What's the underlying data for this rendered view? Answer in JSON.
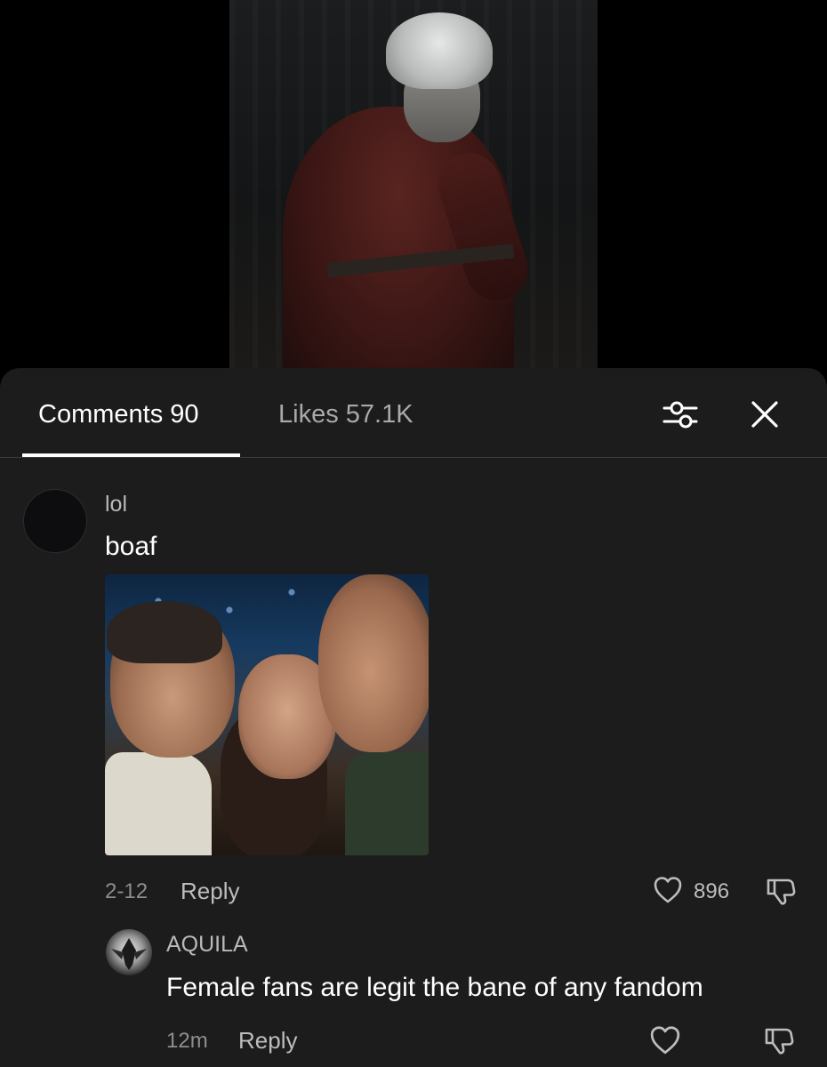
{
  "header": {
    "tabs": [
      {
        "label": "Comments 90",
        "active": true
      },
      {
        "label": "Likes 57.1K",
        "active": false
      }
    ],
    "icons": {
      "filter": "sliders-icon",
      "close": "close-icon"
    }
  },
  "comments": [
    {
      "username": "lol",
      "text": "boaf",
      "has_image": true,
      "date": "2-12",
      "reply_label": "Reply",
      "like_count": "896"
    },
    {
      "username": "AQUILA",
      "text": "Female fans are legit the bane of any fandom",
      "date": "12m",
      "reply_label": "Reply"
    }
  ],
  "colors": {
    "sheet_bg": "#1c1c1c",
    "text_primary": "#ffffff",
    "text_secondary": "#a9a9a9",
    "divider": "#3a3a3a"
  }
}
